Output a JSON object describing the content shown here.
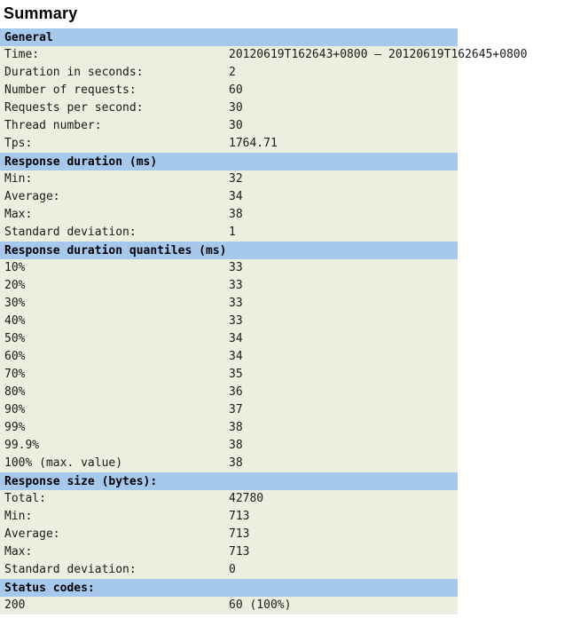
{
  "page": {
    "title": "Summary"
  },
  "sections": [
    {
      "id": "general",
      "header": "General",
      "rows": [
        {
          "label": "Time:",
          "value": "20120619T162643+0800 – 20120619T162645+0800"
        },
        {
          "label": "Duration in seconds:",
          "value": "2"
        },
        {
          "label": "Number of requests:",
          "value": "60"
        },
        {
          "label": "Requests per second:",
          "value": "30"
        },
        {
          "label": "Thread number:",
          "value": "30"
        },
        {
          "label": "Tps:",
          "value": "1764.71"
        }
      ]
    },
    {
      "id": "response-duration",
      "header": "Response duration (ms)",
      "rows": [
        {
          "label": "Min:",
          "value": "32"
        },
        {
          "label": "Average:",
          "value": "34"
        },
        {
          "label": "Max:",
          "value": "38"
        },
        {
          "label": "Standard deviation:",
          "value": "1"
        }
      ]
    },
    {
      "id": "response-duration-quantiles",
      "header": "Response duration quantiles (ms)",
      "rows": [
        {
          "label": "10%",
          "value": "33"
        },
        {
          "label": "20%",
          "value": "33"
        },
        {
          "label": "30%",
          "value": "33"
        },
        {
          "label": "40%",
          "value": "33"
        },
        {
          "label": "50%",
          "value": "34"
        },
        {
          "label": "60%",
          "value": "34"
        },
        {
          "label": "70%",
          "value": "35"
        },
        {
          "label": "80%",
          "value": "36"
        },
        {
          "label": "90%",
          "value": "37"
        },
        {
          "label": "99%",
          "value": "38"
        },
        {
          "label": "99.9%",
          "value": "38"
        },
        {
          "label": "100% (max. value)",
          "value": "38"
        }
      ]
    },
    {
      "id": "response-size",
      "header": "Response size (bytes):",
      "rows": [
        {
          "label": "Total:",
          "value": "42780"
        },
        {
          "label": "Min:",
          "value": "713"
        },
        {
          "label": "Average:",
          "value": "713"
        },
        {
          "label": "Max:",
          "value": "713"
        },
        {
          "label": "Standard deviation:",
          "value": "0"
        }
      ]
    },
    {
      "id": "status-codes",
      "header": "Status codes:",
      "rows": [
        {
          "label": "200",
          "value": "60 (100%)"
        }
      ]
    }
  ],
  "colors": {
    "section_header_bg": "#a6c8ed",
    "data_row_bg": "#eeeee0",
    "page_bg": "#ffffff",
    "text": "#1a1a1a"
  }
}
